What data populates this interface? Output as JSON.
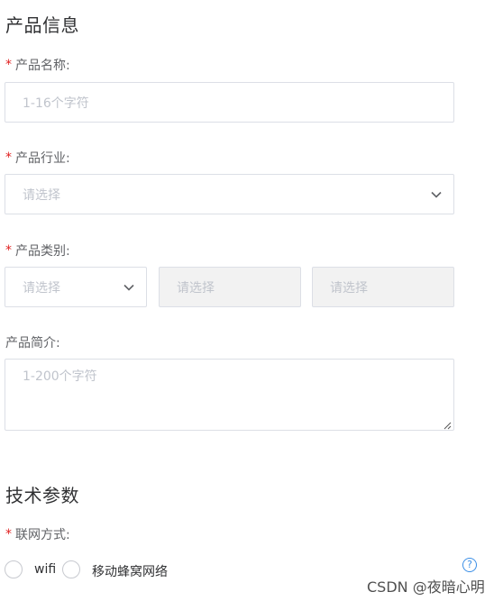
{
  "product_section": {
    "title": "产品信息",
    "name": {
      "label": "产品名称:",
      "required": true,
      "placeholder": "1-16个字符"
    },
    "industry": {
      "label": "产品行业:",
      "required": true,
      "placeholder": "请选择"
    },
    "category": {
      "label": "产品类别:",
      "required": true,
      "level1_placeholder": "请选择",
      "level2_placeholder": "请选择",
      "level3_placeholder": "请选择"
    },
    "intro": {
      "label": "产品简介:",
      "required": false,
      "placeholder": "1-200个字符"
    }
  },
  "tech_section": {
    "title": "技术参数",
    "network": {
      "label": "联网方式:",
      "required": true,
      "options": [
        "wifi",
        "移动蜂窝网络"
      ]
    }
  },
  "help_icon": {
    "glyph": "?"
  },
  "watermark": "CSDN @夜暗心明",
  "colors": {
    "required_star": "#e02020",
    "help_icon": "#3a8ee6",
    "border": "#dcdfe6",
    "placeholder": "#c0c4cc"
  }
}
